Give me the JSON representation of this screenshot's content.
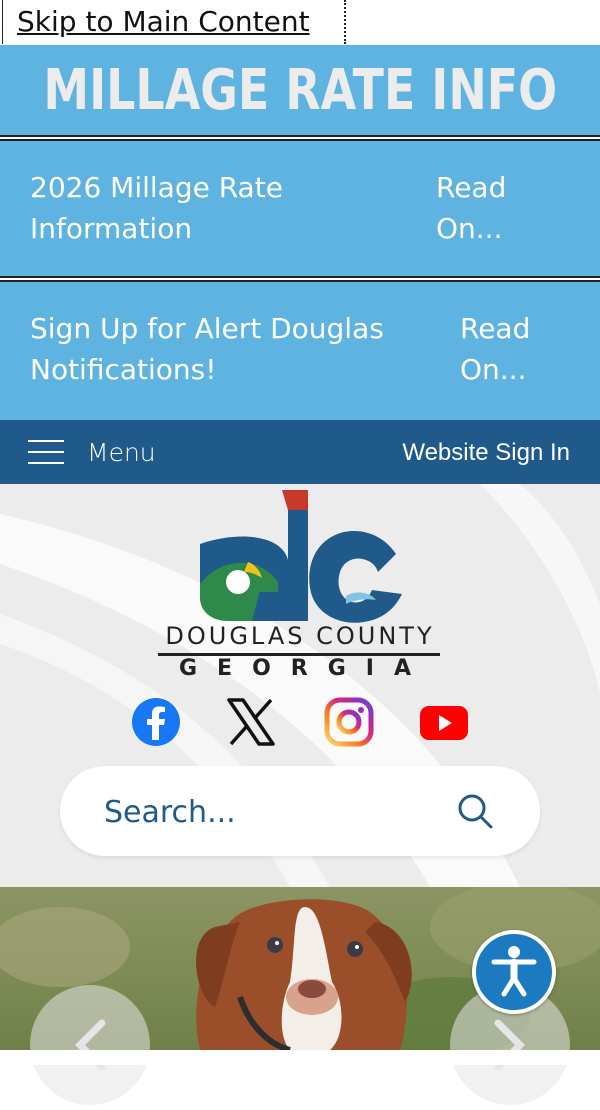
{
  "skip_link": {
    "label": "Skip to Main Content"
  },
  "banner": {
    "title": "MILLAGE RATE INFO"
  },
  "alerts": [
    {
      "text": "2026 Millage Rate Information",
      "read_more": "Read On..."
    },
    {
      "text": "Sign Up for Alert Douglas Notifications!",
      "read_more": "Read On..."
    }
  ],
  "navbar": {
    "menu_label": "Menu",
    "signin_label": "Website Sign In"
  },
  "brand": {
    "line1": "DOUGLAS COUNTY",
    "line2": "GEORGIA"
  },
  "social": [
    "facebook-icon",
    "x-icon",
    "instagram-icon",
    "youtube-icon"
  ],
  "search": {
    "placeholder": "Search..."
  },
  "colors": {
    "banner": "#5eb3e1",
    "navbar": "#1f5a8b",
    "logo_blue": "#1f5a8b",
    "logo_green": "#2e8a4a",
    "logo_red": "#c8382c",
    "logo_yellow": "#f2c21b",
    "header_bg": "#ececec"
  }
}
